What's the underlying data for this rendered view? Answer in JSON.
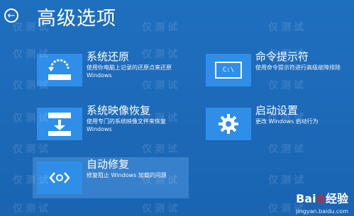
{
  "header": {
    "title": "高级选项"
  },
  "options": [
    {
      "title": "系统还原",
      "desc1": "使用你电脑上记录的还原点来还原",
      "desc2": "Windows"
    },
    {
      "title": "命令提示符",
      "desc1": "使用命令提示符进行高级故障排除",
      "desc2": "",
      "icon_text": "C:\\"
    },
    {
      "title": "系统映像恢复",
      "desc1": "使用专门的系统映像文件来恢复",
      "desc2": "Windows"
    },
    {
      "title": "启动设置",
      "desc1": "更改 Windows 启动行为",
      "desc2": ""
    },
    {
      "title": "自动修复",
      "desc1": "修复阻止 Windows 加载的问题",
      "desc2": ""
    }
  ],
  "watermark": {
    "text": "仅测试"
  },
  "branding": {
    "logo_text": "Bai",
    "logo_text2": "经验",
    "url": "jingyan.baidu.com"
  }
}
